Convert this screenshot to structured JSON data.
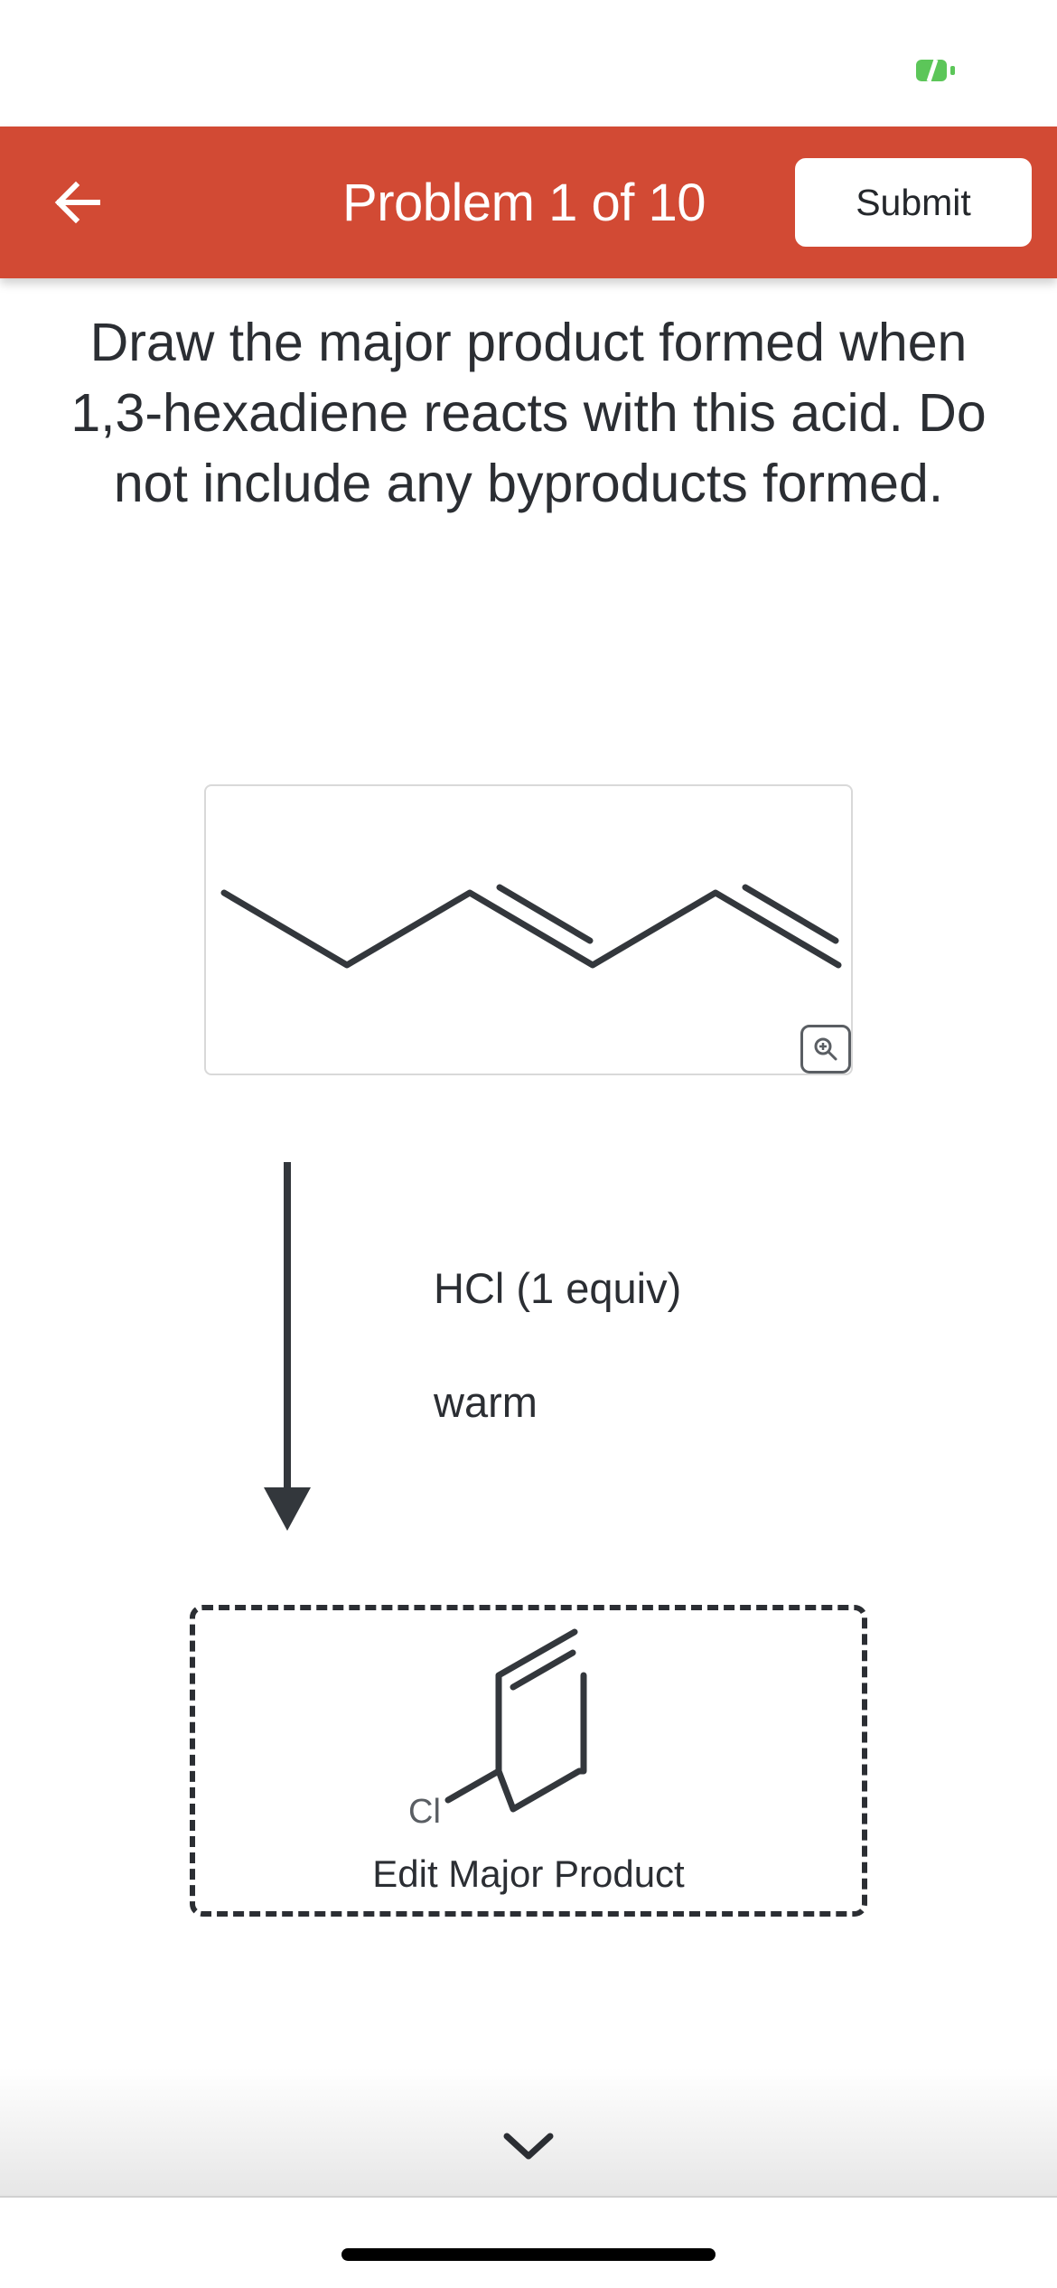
{
  "status_bar": {
    "battery_icon": "battery-charging-icon",
    "battery_color": "#5cc659"
  },
  "header": {
    "back_icon": "arrow-left-icon",
    "title": "Problem 1 of 10",
    "submit_label": "Submit",
    "background_color": "#d24a34"
  },
  "question": {
    "text": "Draw the major product formed when 1,3-hexadiene reacts with this acid.  Do not include any byproducts formed."
  },
  "reactant": {
    "zoom_icon": "zoom-in-icon"
  },
  "reaction": {
    "arrow_icon": "arrow-down-icon",
    "reagents": [
      "HCl (1 equiv)",
      "warm"
    ]
  },
  "product": {
    "atom_label": "Cl",
    "edit_label": "Edit Major Product"
  },
  "bottom": {
    "chevron_icon": "chevron-down-icon"
  }
}
